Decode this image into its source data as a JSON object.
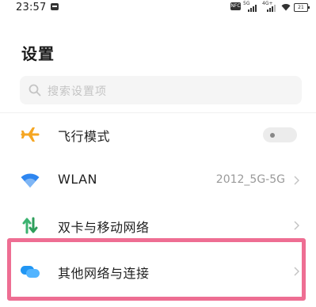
{
  "status_bar": {
    "time": "23:57",
    "nfc": "NFC",
    "signal1_type": "5G",
    "signal2_type": "4G+",
    "battery": "21"
  },
  "header": {
    "title": "设置"
  },
  "search": {
    "placeholder": "搜索设置项"
  },
  "settings": [
    {
      "id": "airplane",
      "label": "飞行模式",
      "icon": "airplane-icon",
      "control": "toggle",
      "toggle_on": false
    },
    {
      "id": "wlan",
      "label": "WLAN",
      "icon": "wifi-icon",
      "value": "2012_5G-5G",
      "control": "chevron"
    },
    {
      "id": "dual",
      "label": "双卡与移动网络",
      "icon": "mobile-data-icon",
      "control": "chevron"
    },
    {
      "id": "other",
      "label": "其他网络与连接",
      "icon": "other-connections-icon",
      "control": "chevron",
      "highlighted": true
    }
  ],
  "colors": {
    "airplane_icon": "#f5a623",
    "wifi_icon": "#2e86f0",
    "mobile_data_icon": "#3cb371",
    "other_connections_icon": "#2196f3",
    "highlight": "#ee6e93"
  }
}
